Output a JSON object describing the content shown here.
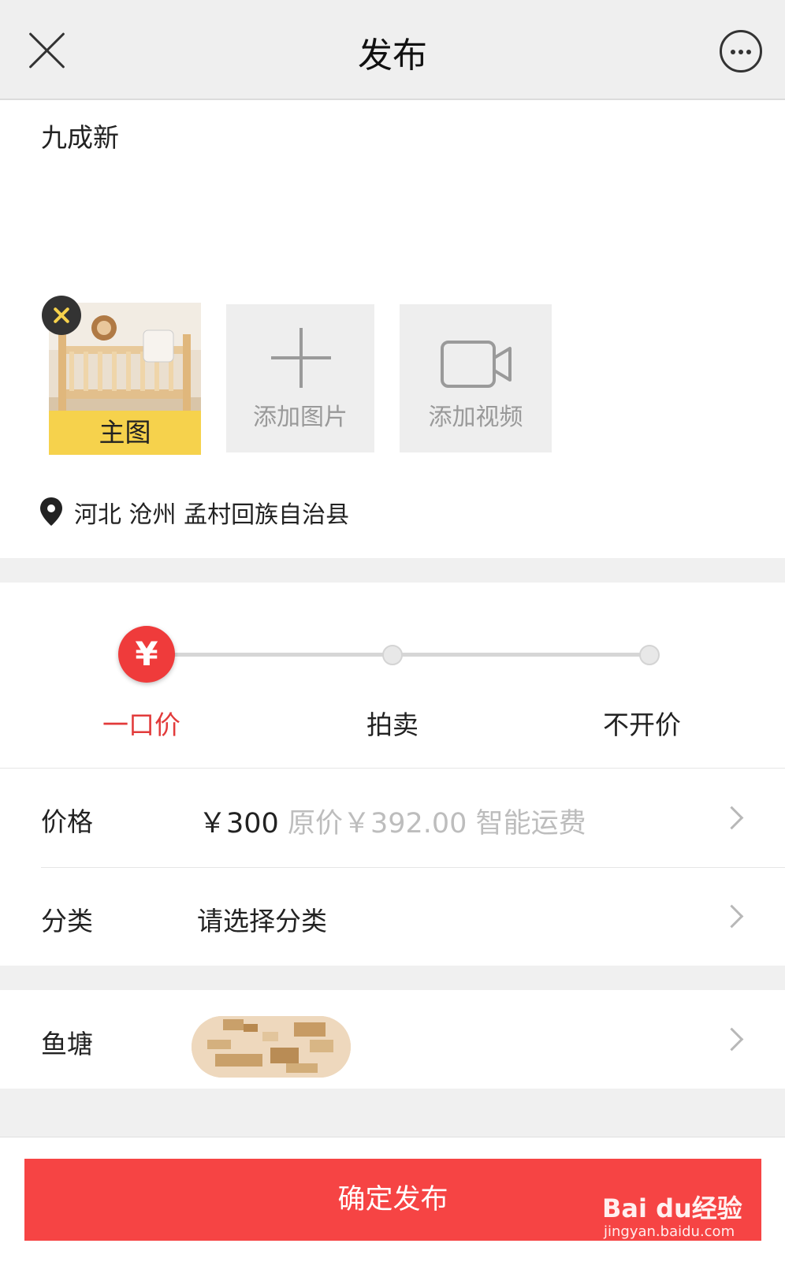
{
  "header": {
    "title": "发布"
  },
  "description": {
    "text": "九成新"
  },
  "media": {
    "main_image_label": "主图",
    "add_image_label": "添加图片",
    "add_video_label": "添加视频"
  },
  "location": {
    "text": "河北 沧州 孟村回族自治县"
  },
  "sale_type": {
    "options": [
      {
        "label": "一口价",
        "selected": true
      },
      {
        "label": "拍卖",
        "selected": false
      },
      {
        "label": "不开价",
        "selected": false
      }
    ]
  },
  "price_row": {
    "label": "价格",
    "price": "￥300",
    "original_price": "原价￥392.00",
    "shipping": "智能运费"
  },
  "category_row": {
    "label": "分类",
    "value": "请选择分类"
  },
  "pond_row": {
    "label": "鱼塘"
  },
  "submit": {
    "label": "确定发布"
  },
  "watermark": {
    "brand": "Bai du经验",
    "url": "jingyan.baidu.com"
  },
  "colors": {
    "accent": "#f64444",
    "badge": "#f6d24c"
  }
}
